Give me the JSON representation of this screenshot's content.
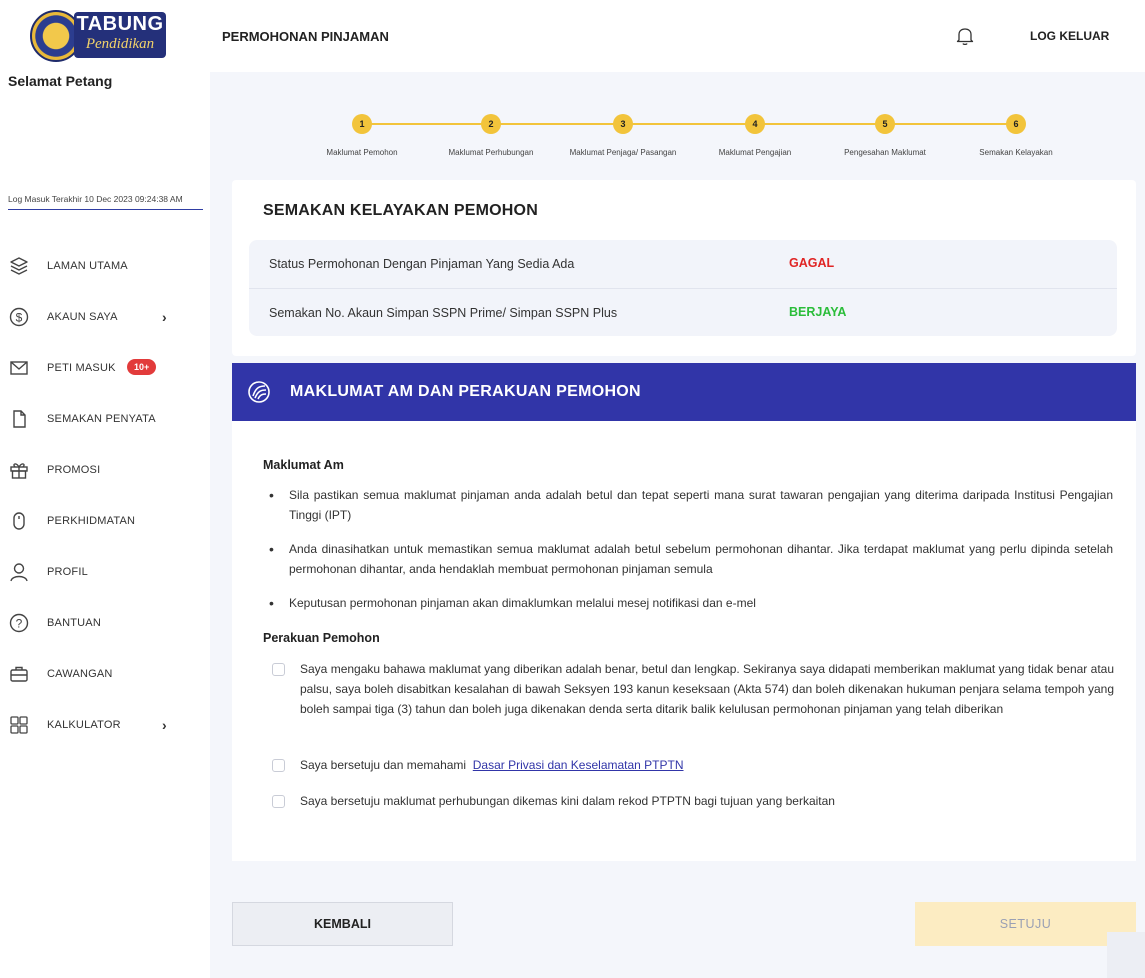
{
  "brand": {
    "logo_line1": "TABUNG",
    "logo_line2": "Pendidikan"
  },
  "greeting": "Selamat Petang",
  "last_login": "Log Masuk Terakhir 10 Dec 2023 09:24:38 AM",
  "sidebar": {
    "items": [
      {
        "label": "LAMAN UTAMA",
        "icon": "layers-icon"
      },
      {
        "label": "AKAUN SAYA",
        "icon": "dollar-circle-icon",
        "chevron": "›"
      },
      {
        "label": "PETI MASUK",
        "icon": "mail-icon",
        "badge": "10+"
      },
      {
        "label": "SEMAKAN PENYATA",
        "icon": "document-icon"
      },
      {
        "label": "PROMOSI",
        "icon": "gift-icon"
      },
      {
        "label": "PERKHIDMATAN",
        "icon": "mouse-icon"
      },
      {
        "label": "PROFIL",
        "icon": "user-icon"
      },
      {
        "label": "BANTUAN",
        "icon": "help-circle-icon"
      },
      {
        "label": "CAWANGAN",
        "icon": "briefcase-icon"
      },
      {
        "label": "KALKULATOR",
        "icon": "calculator-icon",
        "chevron": "›"
      }
    ]
  },
  "header": {
    "title": "PERMOHONAN PINJAMAN",
    "logout": "LOG KELUAR"
  },
  "stepper": {
    "steps": [
      {
        "num": "1",
        "label": "Maklumat Pemohon"
      },
      {
        "num": "2",
        "label": "Maklumat Perhubungan"
      },
      {
        "num": "3",
        "label": "Maklumat Penjaga/ Pasangan"
      },
      {
        "num": "4",
        "label": "Maklumat Pengajian"
      },
      {
        "num": "5",
        "label": "Pengesahan Maklumat"
      },
      {
        "num": "6",
        "label": "Semakan Kelayakan"
      }
    ]
  },
  "eligibility": {
    "title": "SEMAKAN KELAYAKAN PEMOHON",
    "rows": [
      {
        "label": "Status Permohonan Dengan Pinjaman Yang Sedia Ada",
        "value": "GAGAL",
        "color": "#e02424"
      },
      {
        "label": "Semakan No. Akaun Simpan SSPN Prime/ Simpan SSPN Plus",
        "value": "BERJAYA",
        "color": "#2bbd3a"
      }
    ]
  },
  "declaration": {
    "banner_title": "MAKLUMAT AM DAN PERAKUAN PEMOHON",
    "general_heading": "Maklumat Am",
    "bullets": [
      "Sila pastikan semua maklumat pinjaman anda adalah betul dan tepat seperti mana surat tawaran pengajian yang diterima daripada Institusi Pengajian Tinggi (IPT)",
      "Anda dinasihatkan untuk memastikan semua maklumat adalah betul sebelum permohonan dihantar. Jika terdapat maklumat yang perlu dipinda setelah permohonan dihantar, anda hendaklah membuat permohonan pinjaman semula",
      "Keputusan permohonan pinjaman akan dimaklumkan melalui mesej notifikasi dan e-mel"
    ],
    "declaration_heading": "Perakuan Pemohon",
    "check1": "Saya mengaku bahawa maklumat yang diberikan adalah benar, betul dan lengkap. Sekiranya saya didapati memberikan maklumat yang tidak benar atau palsu, saya boleh disabitkan kesalahan di bawah Seksyen 193 kanun keseksaan (Akta 574) dan boleh dikenakan hukuman penjara selama tempoh yang boleh sampai tiga (3) tahun dan boleh juga dikenakan denda serta ditarik balik kelulusan permohonan pinjaman yang telah diberikan",
    "check2_text": "Saya bersetuju dan memahami",
    "check2_link": "Dasar Privasi dan Keselamatan PTPTN",
    "check3": "Saya bersetuju maklumat perhubungan dikemas kini dalam rekod PTPTN bagi tujuan yang berkaitan"
  },
  "actions": {
    "back": "KEMBALI",
    "agree": "SETUJU"
  },
  "colors": {
    "accent": "#3135a8",
    "step": "#f2c43b",
    "fail": "#e02424",
    "success": "#2bbd3a"
  }
}
